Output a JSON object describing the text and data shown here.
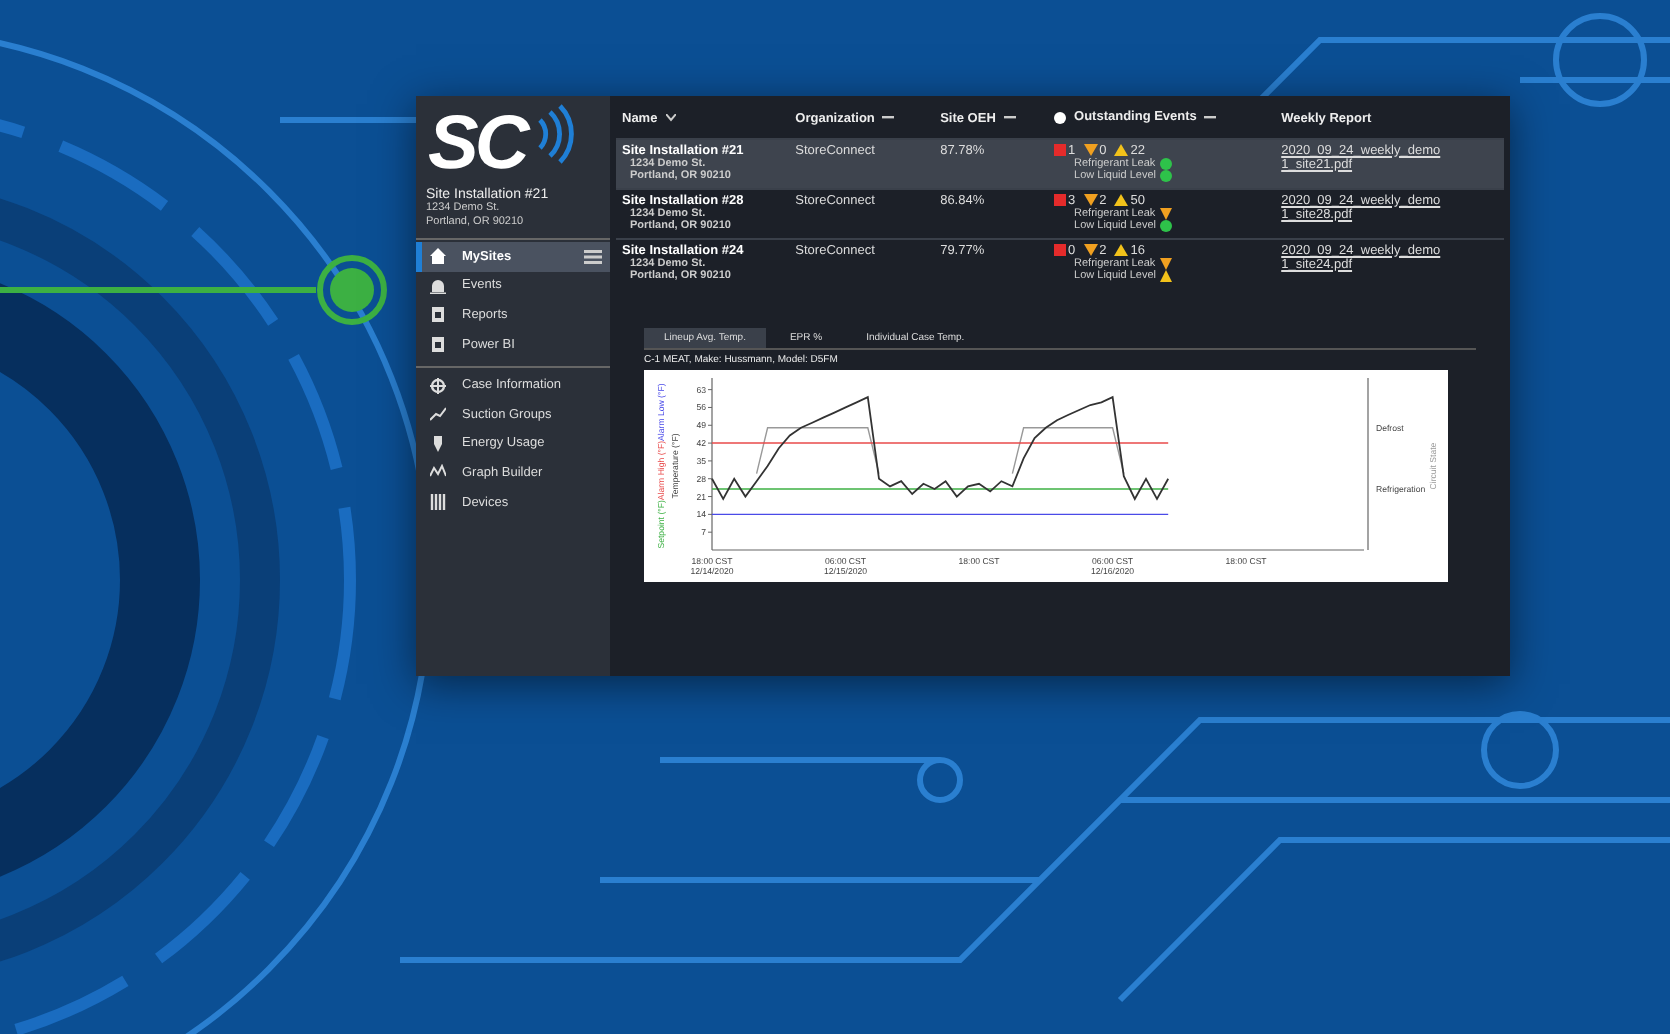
{
  "sidebar": {
    "logo": "SC",
    "site": {
      "name": "Site Installation #21",
      "street": "1234 Demo St.",
      "city": "Portland, OR 90210"
    },
    "nav_groups": [
      [
        {
          "label": "MySites",
          "selected": true
        },
        {
          "label": "Events",
          "selected": false
        },
        {
          "label": "Reports",
          "selected": false
        },
        {
          "label": "Power BI",
          "selected": false
        }
      ],
      [
        {
          "label": "Case Information",
          "selected": false
        },
        {
          "label": "Suction Groups",
          "selected": false
        },
        {
          "label": "Energy Usage",
          "selected": false
        },
        {
          "label": "Graph Builder",
          "selected": false
        },
        {
          "label": "Devices",
          "selected": false
        }
      ]
    ]
  },
  "table": {
    "columns": [
      {
        "label": "Name",
        "sortable": true
      },
      {
        "label": "Organization",
        "collapsible": true
      },
      {
        "label": "Site OEH",
        "collapsible": true
      },
      {
        "label": "Outstanding Events",
        "collapsible": true,
        "dot": true
      },
      {
        "label": "Weekly Report"
      }
    ],
    "rows": [
      {
        "selected": true,
        "name": "Site Installation #21",
        "street": "1234 Demo St.",
        "city": "Portland, OR 90210",
        "organization": "StoreConnect",
        "oeh": "87.78%",
        "counts": [
          "1",
          "0",
          "22"
        ],
        "events": [
          {
            "label": "Refrigerant Leak",
            "kind": "ok"
          },
          {
            "label": "Low Liquid Level",
            "kind": "ok"
          }
        ],
        "report": "2020_09_24_weekly_demo 1_site21.pdf"
      },
      {
        "selected": false,
        "name": "Site Installation #28",
        "street": "1234 Demo St.",
        "city": "Portland, OR 90210",
        "organization": "StoreConnect",
        "oeh": "86.84%",
        "counts": [
          "3",
          "2",
          "50"
        ],
        "events": [
          {
            "label": "Refrigerant Leak",
            "kind": "down"
          },
          {
            "label": "Low Liquid Level",
            "kind": "ok"
          }
        ],
        "report": "2020_09_24_weekly_demo 1_site28.pdf"
      },
      {
        "selected": false,
        "name": "Site Installation #24",
        "street": "1234 Demo St.",
        "city": "Portland, OR 90210",
        "organization": "StoreConnect",
        "oeh": "79.77%",
        "counts": [
          "0",
          "2",
          "16"
        ],
        "events": [
          {
            "label": "Refrigerant Leak",
            "kind": "down"
          },
          {
            "label": "Low Liquid Level",
            "kind": "warn"
          }
        ],
        "report": "2020_09_24_weekly_demo 1_site24.pdf"
      }
    ]
  },
  "chart_panel": {
    "tabs": [
      {
        "label": "Lineup Avg. Temp.",
        "selected": true
      },
      {
        "label": "EPR %",
        "selected": false
      },
      {
        "label": "Individual Case Temp.",
        "selected": false
      }
    ],
    "subtitle": "C-1 MEAT, Make: Hussmann, Model: D5FM",
    "chart_data": {
      "type": "line",
      "y2ticks": [
        "Defrost",
        "Refrigeration"
      ],
      "ylim": [
        0,
        66
      ],
      "yticks": [
        7,
        14,
        21,
        28,
        35,
        42,
        49,
        56,
        63
      ],
      "categories": [
        "18:00 CST 12/14/2020",
        null,
        null,
        null,
        null,
        null,
        null,
        null,
        null,
        null,
        null,
        null,
        "06:00 CST 12/15/2020",
        null,
        null,
        null,
        null,
        null,
        null,
        null,
        null,
        null,
        null,
        null,
        "18:00 CST",
        null,
        null,
        null,
        null,
        null,
        null,
        null,
        null,
        null,
        null,
        null,
        "06:00 CST 12/16/2020",
        null,
        null,
        null,
        null,
        null,
        null,
        null,
        null,
        null,
        null,
        null,
        "18:00 CST",
        null,
        null,
        null,
        null,
        null,
        null,
        null
      ],
      "series": [
        {
          "name": "Temperature (°F)",
          "color": "#333333",
          "values": [
            28,
            20,
            28,
            21,
            27,
            33,
            40,
            45,
            48,
            50,
            52,
            54,
            56,
            58,
            60,
            28,
            25,
            27,
            22,
            26,
            24,
            27,
            21,
            25,
            26,
            23,
            27,
            25,
            36,
            44,
            48,
            51,
            53,
            55,
            57,
            58,
            60,
            29,
            20,
            28,
            20,
            28,
            null,
            null,
            null,
            null,
            null,
            null,
            null,
            null,
            null,
            null,
            null,
            null,
            null,
            null
          ]
        },
        {
          "name": "Setpoint (°F)",
          "color": "#3cb043",
          "values": [
            24,
            24,
            24,
            24,
            24,
            24,
            24,
            24,
            24,
            24,
            24,
            24,
            24,
            24,
            24,
            24,
            24,
            24,
            24,
            24,
            24,
            24,
            24,
            24,
            24,
            24,
            24,
            24,
            24,
            24,
            24,
            24,
            24,
            24,
            24,
            24,
            24,
            24,
            24,
            24,
            24,
            24,
            null,
            null,
            null,
            null,
            null,
            null,
            null,
            null,
            null,
            null,
            null,
            null,
            null,
            null
          ]
        },
        {
          "name": "Alarm High (°F)",
          "color": "#e84a4a",
          "values": [
            42,
            42,
            42,
            42,
            42,
            42,
            42,
            42,
            42,
            42,
            42,
            42,
            42,
            42,
            42,
            42,
            42,
            42,
            42,
            42,
            42,
            42,
            42,
            42,
            42,
            42,
            42,
            42,
            42,
            42,
            42,
            42,
            42,
            42,
            42,
            42,
            42,
            42,
            42,
            42,
            42,
            42,
            null,
            null,
            null,
            null,
            null,
            null,
            null,
            null,
            null,
            null,
            null,
            null,
            null,
            null
          ]
        },
        {
          "name": "Alarm Low (°F)",
          "color": "#4a4ae8",
          "values": [
            14,
            14,
            14,
            14,
            14,
            14,
            14,
            14,
            14,
            14,
            14,
            14,
            14,
            14,
            14,
            14,
            14,
            14,
            14,
            14,
            14,
            14,
            14,
            14,
            14,
            14,
            14,
            14,
            14,
            14,
            14,
            14,
            14,
            14,
            14,
            14,
            14,
            14,
            14,
            14,
            14,
            14,
            null,
            null,
            null,
            null,
            null,
            null,
            null,
            null,
            null,
            null,
            null,
            null,
            null,
            null
          ]
        },
        {
          "name": "Circuit State",
          "color": "#999999",
          "values": [
            null,
            null,
            null,
            null,
            30,
            48,
            48,
            48,
            48,
            48,
            48,
            48,
            48,
            48,
            48,
            30,
            null,
            null,
            null,
            null,
            null,
            null,
            null,
            null,
            null,
            null,
            null,
            30,
            48,
            48,
            48,
            48,
            48,
            48,
            48,
            48,
            48,
            30,
            null,
            null,
            null,
            null,
            null,
            null,
            null,
            null,
            null,
            null,
            null,
            null,
            null,
            null,
            null,
            null,
            null,
            null
          ]
        }
      ]
    }
  }
}
